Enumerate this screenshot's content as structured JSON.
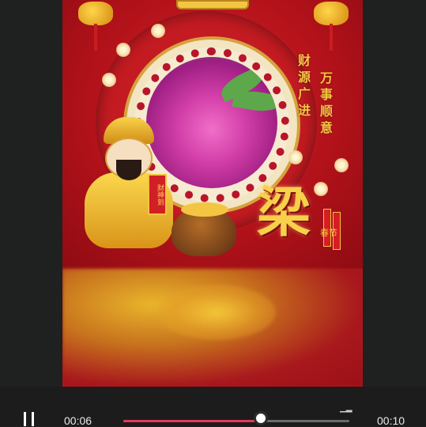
{
  "video": {
    "left_greeting": [
      "财",
      "源",
      "广",
      "进"
    ],
    "right_greeting": [
      "万",
      "事",
      "顺",
      "意"
    ],
    "surname": "梁",
    "scroll_text": "财神到",
    "firecracker_text": "春节"
  },
  "player": {
    "elapsed": "00:06",
    "duration": "00:10",
    "progress_percent": 61,
    "accent_color": "#e6375a",
    "pause_icon": "pause-icon"
  }
}
